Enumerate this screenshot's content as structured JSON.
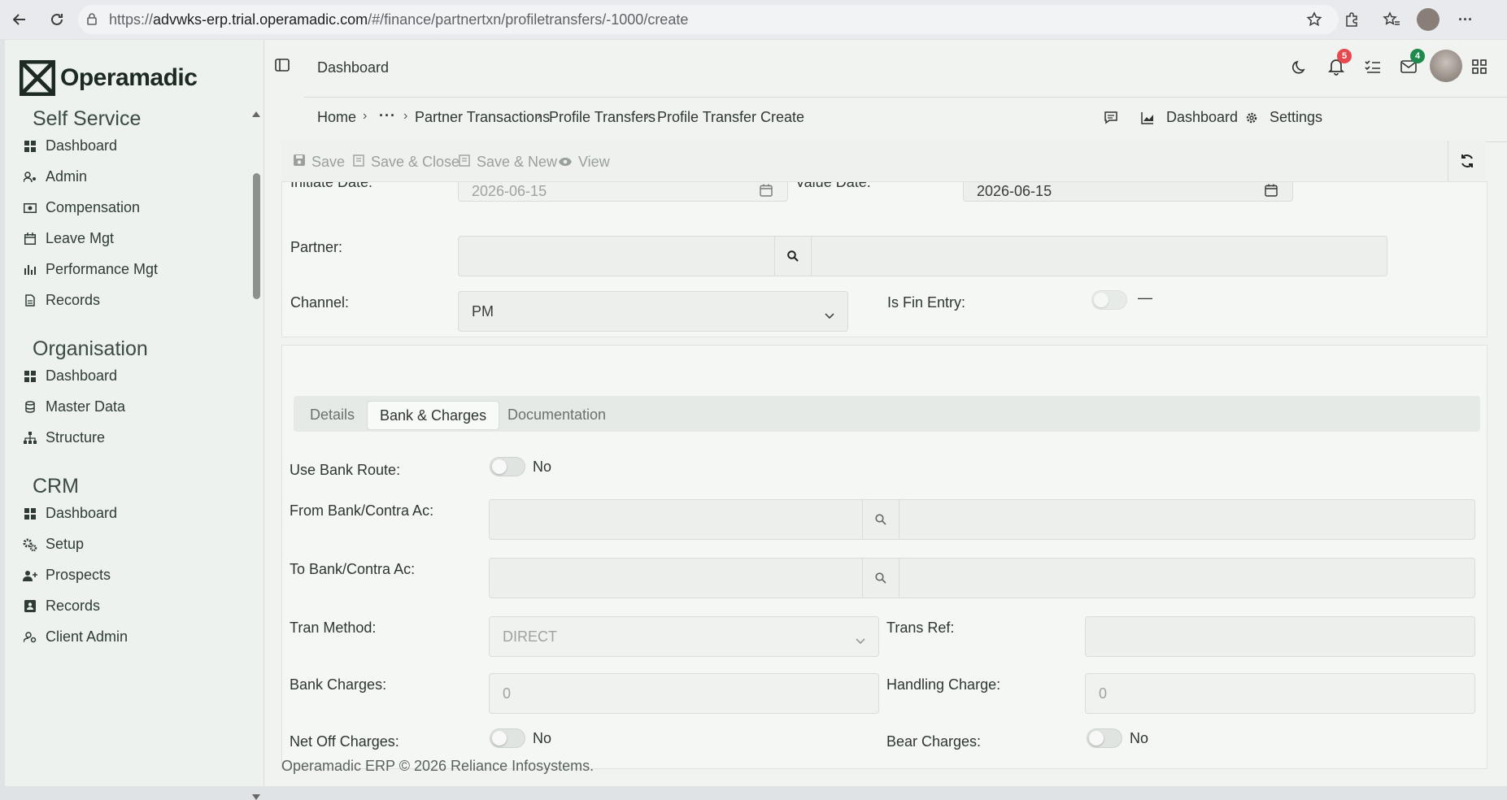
{
  "browser": {
    "url_prefix": "https://",
    "url_host": "advwks-erp.trial.operamadic.com",
    "url_path": "/#/finance/partnertxn/profiletransfers/-1000/create"
  },
  "app": {
    "brand": "Operamadic",
    "header_title": "Dashboard",
    "notifications_count": "5",
    "messages_count": "4"
  },
  "sidebar": {
    "self_service": {
      "title": "Self Service",
      "items": [
        "Dashboard",
        "Admin",
        "Compensation",
        "Leave Mgt",
        "Performance Mgt",
        "Records"
      ]
    },
    "organisation": {
      "title": "Organisation",
      "items": [
        "Dashboard",
        "Master Data",
        "Structure"
      ]
    },
    "crm": {
      "title": "CRM",
      "items": [
        "Dashboard",
        "Setup",
        "Prospects",
        "Records",
        "Client Admin"
      ]
    }
  },
  "breadcrumb": {
    "home": "Home",
    "ellipsis": "···",
    "partner_transactions": "Partner Transactions",
    "profile_transfers": "Profile Transfers",
    "current": "Profile Transfer Create",
    "dashboard": "Dashboard",
    "settings": "Settings"
  },
  "toolbar": {
    "save": "Save",
    "save_close": "Save & Close",
    "save_new": "Save & New",
    "view": "View"
  },
  "form": {
    "initiate_date_label": "Initiate Date:",
    "initiate_date": "2026-06-15",
    "value_date_label": "Value Date:",
    "value_date": "2026-06-15",
    "partner_label": "Partner:",
    "channel_label": "Channel:",
    "channel": "PM",
    "is_fin_entry_label": "Is Fin Entry:",
    "is_fin_entry_value": "—"
  },
  "tabs": [
    "Details",
    "Bank & Charges",
    "Documentation"
  ],
  "bank": {
    "use_bank_route_label": "Use Bank Route:",
    "use_bank_route": "No",
    "from_bank_label": "From Bank/Contra Ac:",
    "to_bank_label": "To Bank/Contra Ac:",
    "tran_method_label": "Tran Method:",
    "tran_method": "DIRECT",
    "trans_ref_label": "Trans Ref:",
    "bank_charges_label": "Bank Charges:",
    "bank_charges": "0",
    "handling_charge_label": "Handling Charge:",
    "handling_charge": "0",
    "net_off_label": "Net Off Charges:",
    "net_off": "No",
    "bear_charges_label": "Bear Charges:",
    "bear_charges": "No"
  },
  "footer": "Operamadic ERP © 2026 Reliance Infosystems."
}
